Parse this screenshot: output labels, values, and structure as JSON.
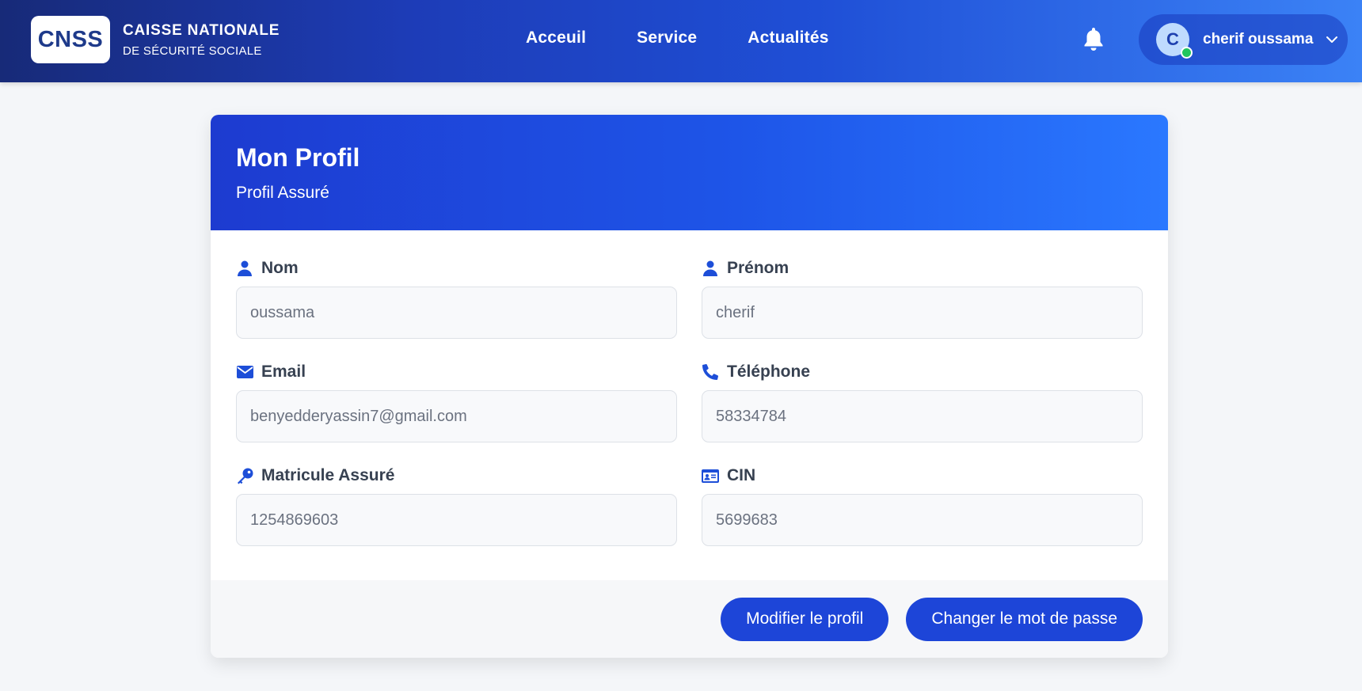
{
  "header": {
    "logo_text": "CNSS",
    "org_line1": "CAISSE NATIONALE",
    "org_line2": "DE SÉCURITÉ SOCIALE",
    "nav": [
      {
        "label": "Acceuil"
      },
      {
        "label": "Service"
      },
      {
        "label": "Actualités"
      }
    ],
    "user": {
      "initial": "C",
      "name": "cherif oussama",
      "status": "online"
    }
  },
  "profile": {
    "title": "Mon Profil",
    "subtitle": "Profil Assuré",
    "fields": {
      "nom": {
        "label": "Nom",
        "value": "oussama",
        "icon": "user-icon"
      },
      "prenom": {
        "label": "Prénom",
        "value": "cherif",
        "icon": "user-icon"
      },
      "email": {
        "label": "Email",
        "value": "benyedderyassin7@gmail.com",
        "icon": "envelope-icon"
      },
      "telephone": {
        "label": "Téléphone",
        "value": "58334784",
        "icon": "phone-icon"
      },
      "matricule": {
        "label": "Matricule Assuré",
        "value": "1254869603",
        "icon": "key-icon"
      },
      "cin": {
        "label": "CIN",
        "value": "5699683",
        "icon": "id-card-icon"
      }
    },
    "actions": {
      "edit_label": "Modifier le profil",
      "password_label": "Changer le mot de passe"
    }
  },
  "colors": {
    "accent": "#1d45d8",
    "icon": "#1d4ed8",
    "online": "#22c55e"
  }
}
